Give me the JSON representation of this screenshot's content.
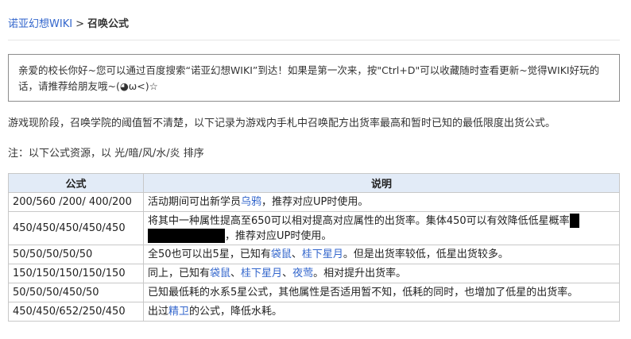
{
  "breadcrumb": {
    "home": "诺亚幻想WIKI",
    "separator": ">",
    "current": "召唤公式"
  },
  "notice": {
    "text": "亲爱的校长你好~您可以通过百度搜索“诺亚幻想WIKI”到达！如果是第一次来，按\"Ctrl+D\"可以收藏随时查看更新~觉得WIKI好玩的话，请推荐给朋友哦~(◕ω<)☆"
  },
  "intro": "游戏现阶段，召唤学院的阈值暂不清楚，以下记录为游戏内手札中召唤配方出货率最高和暂时已知的最低限度出货公式。",
  "note": "注：以下公式资源，以 光/暗/风/水/炎 排序",
  "table": {
    "headers": {
      "formula": "公式",
      "description": "说明"
    },
    "rows": [
      {
        "formula": "200/560 /200/ 400/200",
        "desc_before": "活动期间可出新学员",
        "link1": "乌鸦",
        "desc_after": "，推荐对应UP时使用。"
      },
      {
        "formula": "450/450/450/450/450",
        "desc_line1": "将其中一种属性提高至650可以相对提高对应属性的出货率。集体450可以有效降低低星概率",
        "desc_line2": "，推荐对应UP时使用。"
      },
      {
        "formula": "50/50/50/50/50",
        "desc_before": "全50也可以出5星，已知有",
        "link1": "袋鼠",
        "sep1": "、",
        "link2": "桂下星月",
        "desc_after": "。但是出货率较低，低星出货较多。"
      },
      {
        "formula": "150/150/150/150/150",
        "desc_before": "同上，已知有",
        "link1": "袋鼠",
        "sep1": "、",
        "link2": "桂下星月",
        "sep2": "、",
        "link3": "夜莺",
        "desc_after": "。相对提升出货率。"
      },
      {
        "formula": "50/50/50/450/50",
        "desc_before": "已知最低耗的水系5星公式，其他属性是否适用暂不知，低耗的同时，也增加了低星的出货率。"
      },
      {
        "formula": "450/450/652/250/450",
        "desc_before": "出过",
        "link1": "精卫",
        "desc_after": "的公式，降低水耗。"
      }
    ]
  },
  "colors": {
    "link": "#3366cc",
    "table_header_bg": "#e2ebf7",
    "border": "#c8c8c8",
    "redaction": "#000000"
  }
}
